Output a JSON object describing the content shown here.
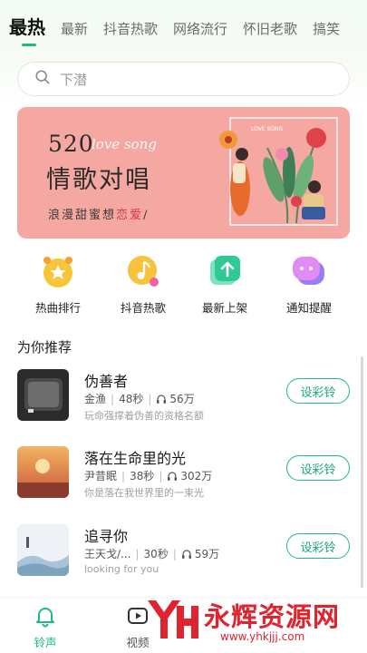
{
  "tabs": [
    "最热",
    "最新",
    "抖音热歌",
    "网络流行",
    "怀旧老歌",
    "搞笑"
  ],
  "active_tab": "最热",
  "search": {
    "placeholder": "下潜"
  },
  "banner": {
    "number": "520",
    "script": "love song",
    "title": "情歌对唱",
    "subtitle_prefix": "浪漫甜蜜想",
    "subtitle_highlight": "恋爱",
    "subtitle_suffix": "/",
    "art_caption": "LOVE SONG"
  },
  "quick_entries": [
    {
      "label": "热曲排行",
      "icon": "hot-chart-icon",
      "color": "#f8c53a"
    },
    {
      "label": "抖音热歌",
      "icon": "music-note-icon",
      "color": "#f7c23c"
    },
    {
      "label": "最新上架",
      "icon": "upload-icon",
      "color": "#2ec995"
    },
    {
      "label": "通知提醒",
      "icon": "chat-bubble-icon",
      "color": "#c77cf5"
    }
  ],
  "section_title": "为你推荐",
  "songs": [
    {
      "title": "伪善者",
      "artist": "金渔",
      "duration": "48秒",
      "plays": "56万",
      "desc": "玩命强撑着伪善的资格名额",
      "button": "设彩铃"
    },
    {
      "title": "落在生命里的光",
      "artist": "尹昔眠",
      "duration": "38秒",
      "plays": "302万",
      "desc": "你是落在我世界里的一束光",
      "button": "设彩铃"
    },
    {
      "title": "追寻你",
      "artist": "王天戈/...",
      "duration": "30秒",
      "plays": "59万",
      "desc": "looking for you",
      "button": "设彩铃"
    }
  ],
  "bottom_nav": [
    {
      "label": "铃声",
      "icon": "bell-icon",
      "active": true
    },
    {
      "label": "视频",
      "icon": "video-icon",
      "active": false
    }
  ],
  "watermark": {
    "text": "永辉资源网",
    "url": "www.yhkjjj.com"
  },
  "colors": {
    "accent": "#1fb989",
    "banner_bg": "#f4a8a1",
    "watermark": "#e0242f"
  }
}
